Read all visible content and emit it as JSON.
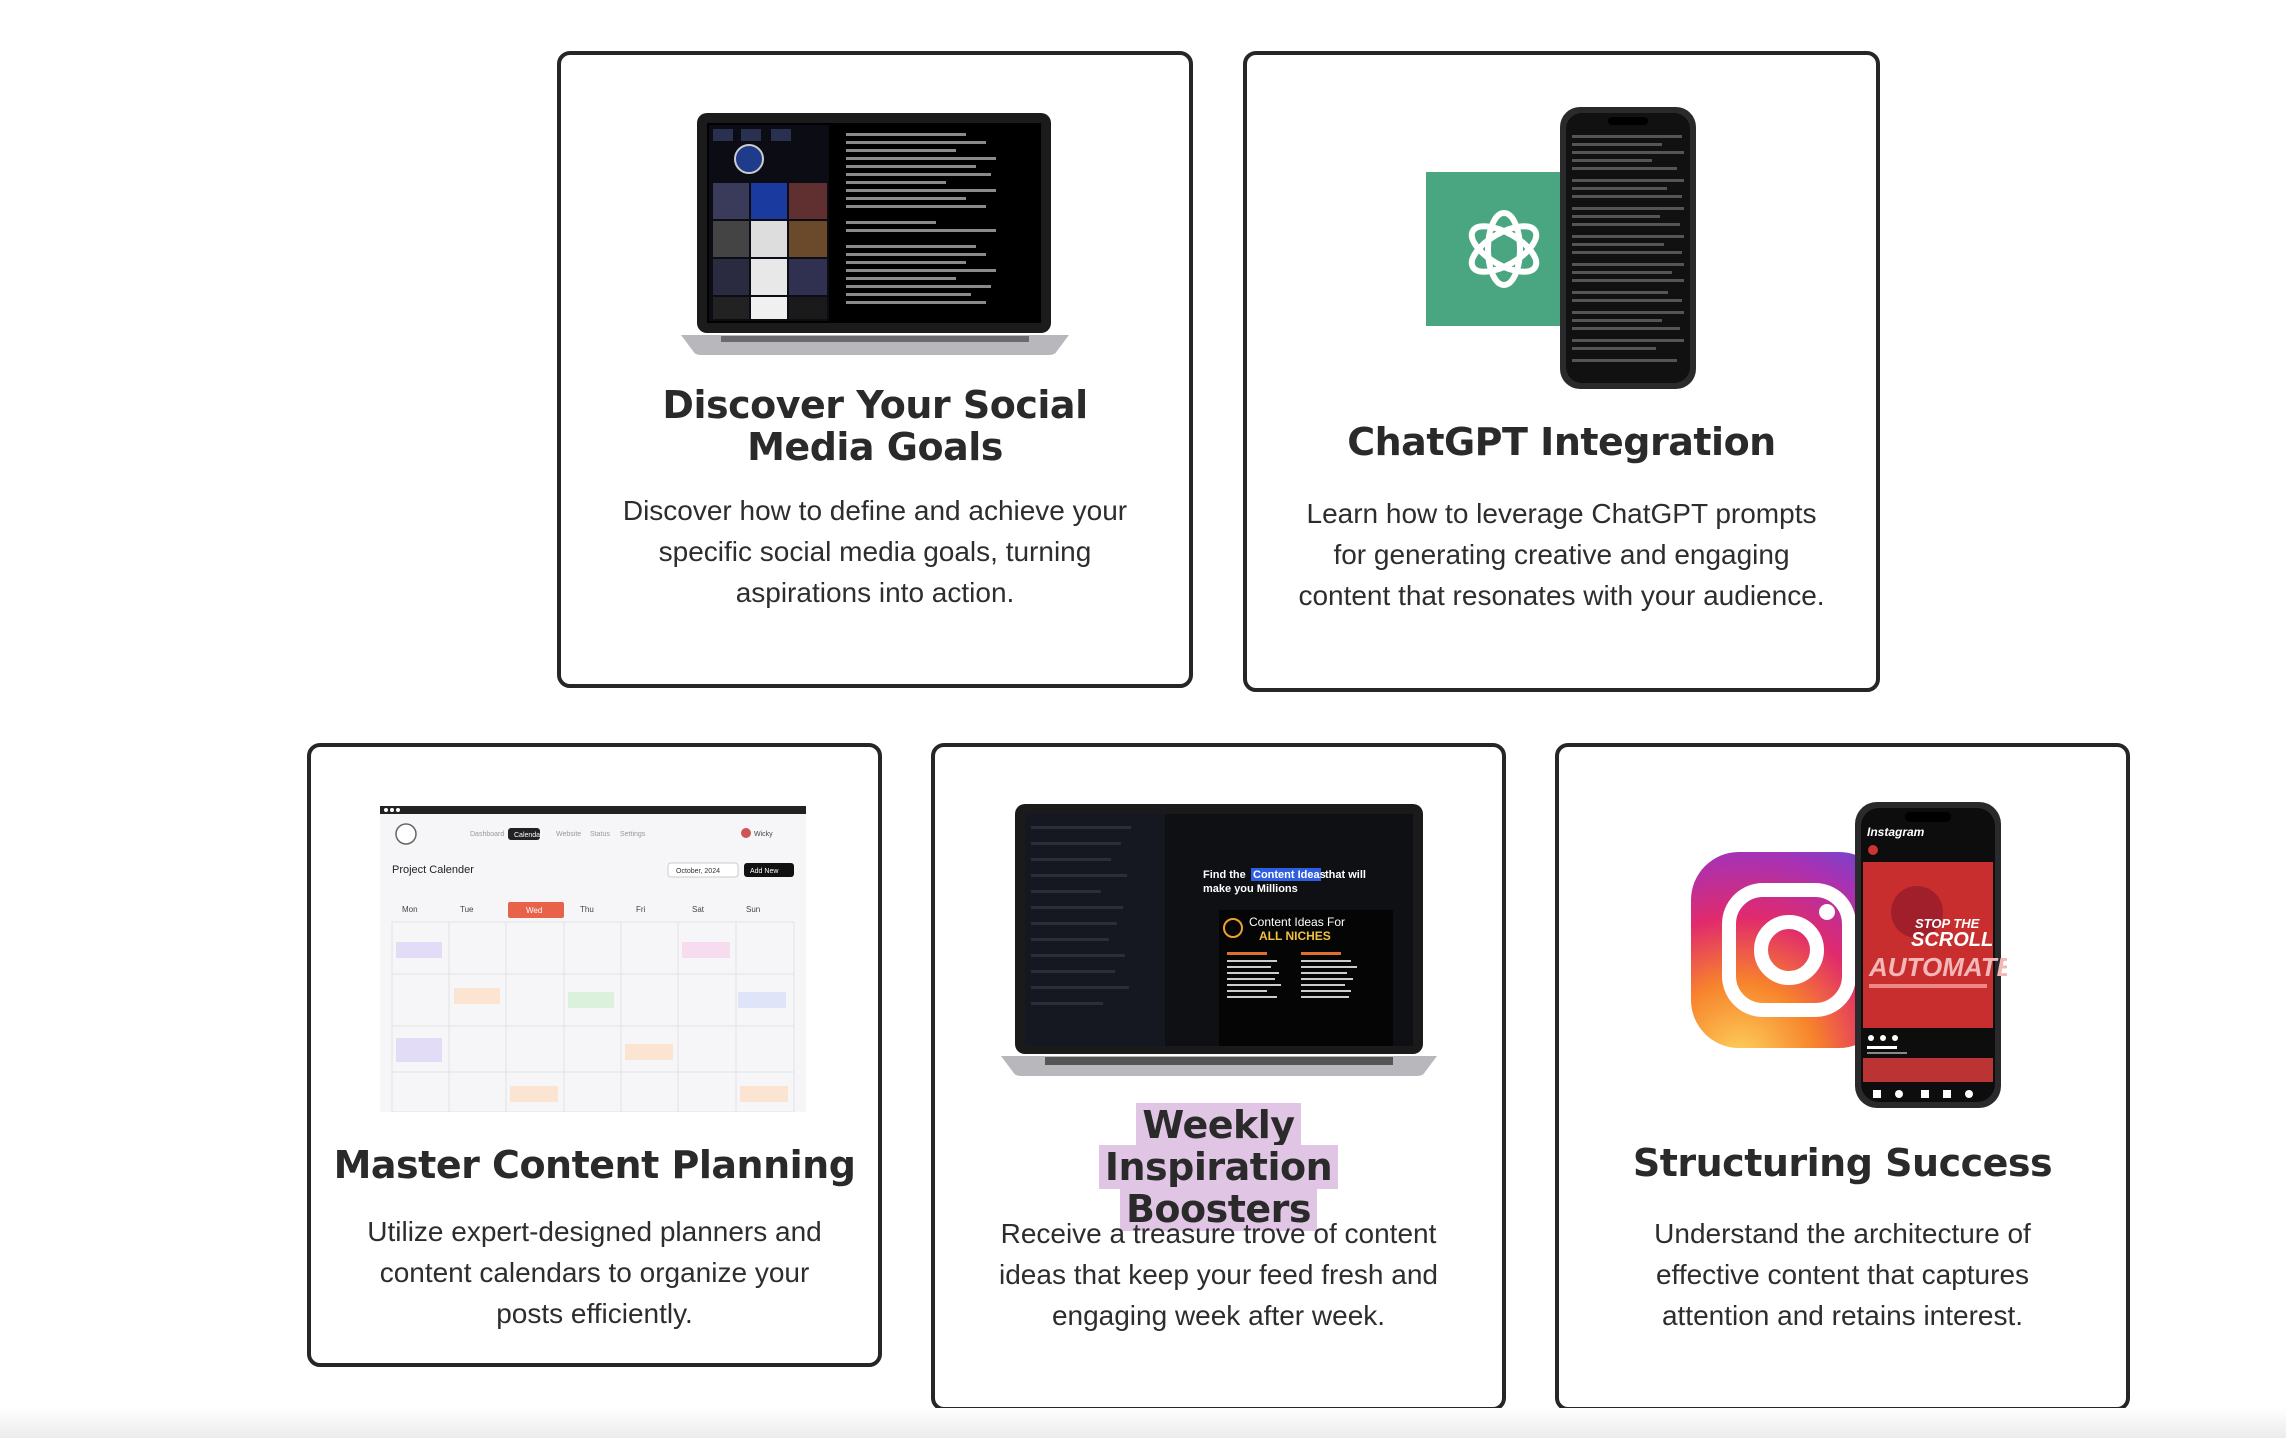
{
  "cards": [
    {
      "title": "Discover Your Social Media Goals",
      "description": "Discover how to define and achieve your specific social media goals, turning aspirations into action.",
      "image_icon": "laptop-social-feed-image"
    },
    {
      "title": "ChatGPT Integration",
      "description": "Learn how to leverage ChatGPT prompts for generating creative and engaging content that resonates with your audience.",
      "image_icon": "chatgpt-logo-phone-image"
    },
    {
      "title": "Master Content Planning",
      "description": "Utilize expert-designed planners and content calendars to organize your posts efficiently.",
      "image_icon": "project-calendar-image",
      "calendar": {
        "nav": [
          "Dashboard",
          "Calendar",
          "Website",
          "Status",
          "Settings"
        ],
        "user": "Wicky",
        "heading": "Project Calender",
        "month": "October, 2024",
        "add_button": "Add New",
        "days": [
          "Mon",
          "Tue",
          "Wed",
          "Thu",
          "Fri",
          "Sat",
          "Sun"
        ]
      }
    },
    {
      "title": "Weekly Inspiration Boosters",
      "description": "Receive a treasure trove of content ideas that keep your feed fresh and engaging week after week.",
      "image_icon": "laptop-content-ideas-image",
      "screen_text": {
        "headline_a": "Find the",
        "headline_b": "Content Ideas",
        "headline_c": "that will",
        "headline_d": "make you Millions",
        "panel_a": "Content Ideas For",
        "panel_b": "ALL NICHES"
      }
    },
    {
      "title": "Structuring Success",
      "description": "Understand the architecture of effective content that captures attention and retains interest.",
      "image_icon": "instagram-logo-phone-image",
      "phone_text": {
        "app": "Instagram",
        "line1": "STOP THE",
        "line2": "SCROLL",
        "line3": "AUTOMATE"
      }
    }
  ],
  "colors": {
    "border": "#262626",
    "highlight": "#e0c6e4",
    "chatgpt_green": "#4aa681"
  }
}
